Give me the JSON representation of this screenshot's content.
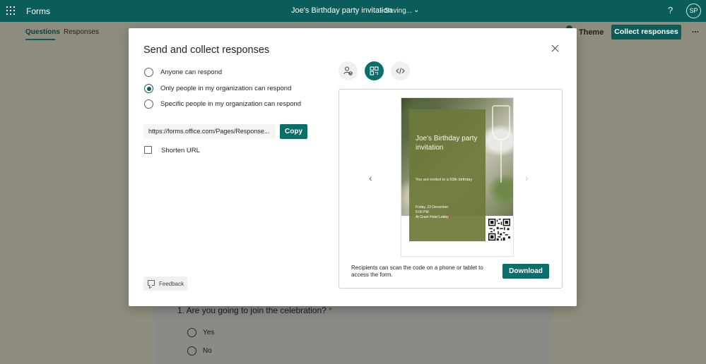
{
  "appbar": {
    "app_name": "Forms",
    "doc_title": "Joe's Birthday party invitation",
    "save_status": "-  Saving...",
    "help_icon": "help-question-icon",
    "avatar_initials": "SP"
  },
  "subbar": {
    "tabs": [
      "Questions",
      "Responses"
    ],
    "theme_label": "Theme",
    "collect_label": "Collect responses",
    "more_label": "..."
  },
  "form": {
    "question": "1. Are you going to join the celebration?",
    "required_mark": "*",
    "options": [
      "Yes",
      "No"
    ]
  },
  "modal": {
    "title": "Send and collect responses",
    "audience_options": [
      {
        "label": "Anyone can respond",
        "selected": false
      },
      {
        "label": "Only people in my organization can respond",
        "selected": true
      },
      {
        "label": "Specific people in my organization can respond",
        "selected": false
      }
    ],
    "url": "https://forms.office.com/Pages/Response...",
    "copy_label": "Copy",
    "shorten_label": "Shorten URL",
    "shorten_checked": false,
    "feedback_label": "Feedback",
    "share_modes": [
      "people-share-icon",
      "qr-code-icon",
      "embed-code-icon"
    ],
    "active_mode": "qr-code-icon",
    "preview": {
      "title": "Joe's Birthday party invitation",
      "subtitle": "You are invited to a 50th birthday",
      "date": "Friday, 23 December",
      "time": "5:00 PM",
      "place": "At Grant Hotel Lobby"
    },
    "qr_caption": "Recipients can scan the code on a phone or tablet to access the form.",
    "download_label": "Download"
  },
  "colors": {
    "brand": "#0a5d5a",
    "accent": "#0a6e6a",
    "card_green": "#6e7a3a"
  }
}
